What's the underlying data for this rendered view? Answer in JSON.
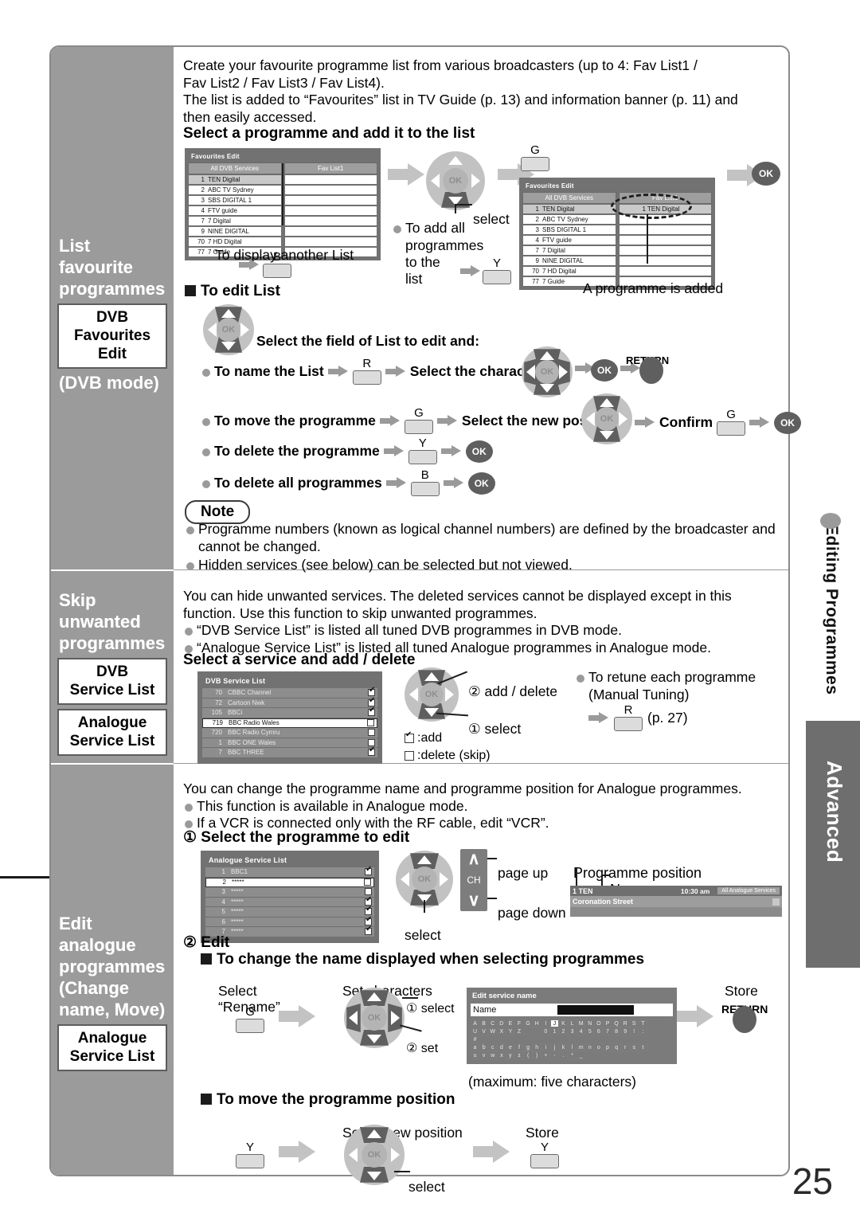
{
  "page": {
    "number": "25"
  },
  "side_tabs": {
    "editing": "Editing Programmes",
    "advanced": "Advanced"
  },
  "sidebar": {
    "sections": [
      {
        "title": "List\nfavourite\nprogrammes",
        "boxes": [
          "DVB\nFavourites\nEdit"
        ],
        "mode": "(DVB mode)"
      },
      {
        "title": "Skip\nunwanted\nprogrammes",
        "boxes": [
          "DVB\nService List",
          "Analogue\nService List"
        ],
        "mode": ""
      },
      {
        "title": "Edit analogue\nprogrammes\n(Change\nname, Move)",
        "boxes": [
          "Analogue\nService List"
        ],
        "mode": ""
      }
    ]
  },
  "section1": {
    "intro_l1": "Create your favourite programme list from various broadcasters (up to 4: Fav List1 /",
    "intro_l2": "Fav List2 / Fav List3 / Fav List4).",
    "intro_l3": "The list is added to “Favourites” list in TV Guide (p. 13) and information banner (p. 11) and",
    "intro_l4": "then easily accessed.",
    "heading": "Select a programme and add it to the list",
    "tv1": {
      "title": "Favourites Edit",
      "col_left": "All DVB Services",
      "col_right": "Fav List1",
      "rows": [
        {
          "num": "1",
          "name": "TEN Digital",
          "selected": true
        },
        {
          "num": "2",
          "name": "ABC TV Sydney",
          "selected": false
        },
        {
          "num": "3",
          "name": "SBS DIGITAL 1",
          "selected": false
        },
        {
          "num": "4",
          "name": "FTV guide",
          "selected": false
        },
        {
          "num": "7",
          "name": "7 Digital",
          "selected": false
        },
        {
          "num": "9",
          "name": "NINE DIGITAL",
          "selected": false
        },
        {
          "num": "70",
          "name": "7 HD Digital",
          "selected": false
        },
        {
          "num": "77",
          "name": "7 Guide",
          "selected": false
        }
      ]
    },
    "caption_another_list": "To display another List",
    "key_b": "B",
    "select_label": "select",
    "add_all_l1": "To add all",
    "add_all_l2": "programmes",
    "add_all_l3": "to the list",
    "key_y": "Y",
    "key_g": "G",
    "ok_label": "OK",
    "tv2": {
      "title": "Favourites Edit",
      "col_left": "All DVB Services",
      "col_right": "Fav List1",
      "added_value": "1 TEN Digital"
    },
    "caption_added": "A programme is added",
    "edit_list_heading": "To edit List",
    "select_field_text": "Select the field of List to edit and:",
    "steps": [
      {
        "label": "To name the List",
        "key": "R",
        "mid": "Select the character",
        "confirm": "",
        "confirm_key": "",
        "return_label": "RETURN"
      },
      {
        "label": "To move the programme",
        "key": "G",
        "mid": "Select the new position",
        "confirm": "Confirm",
        "confirm_key": "G",
        "return_label": ""
      },
      {
        "label": "To delete the programme",
        "key": "Y",
        "mid": "",
        "confirm": "",
        "confirm_key": "",
        "return_label": ""
      },
      {
        "label": "To delete all programmes",
        "key": "B",
        "mid": "",
        "confirm": "",
        "confirm_key": "",
        "return_label": ""
      }
    ],
    "note": {
      "title": "Note",
      "items": [
        "Programme numbers (known as logical channel numbers) are defined by the broadcaster and cannot be changed.",
        "Hidden services (see below) can be selected but not viewed."
      ]
    }
  },
  "section2": {
    "intro_l1": "You can hide unwanted services. The deleted services cannot be displayed except in this",
    "intro_l2": "function. Use this function to skip unwanted programmes.",
    "bullets": [
      "“DVB Service List” is listed all tuned DVB programmes in DVB mode.",
      "“Analogue Service List” is listed all tuned Analogue programmes in Analogue mode."
    ],
    "heading": "Select a service and add / delete",
    "tv": {
      "title": "DVB Service List",
      "rows": [
        {
          "num": "70",
          "name": "CBBC Channel",
          "checked": true,
          "highlight": false
        },
        {
          "num": "72",
          "name": "Cartoon Nwk",
          "checked": true,
          "highlight": false
        },
        {
          "num": "105",
          "name": "BBCi",
          "checked": true,
          "highlight": false
        },
        {
          "num": "719",
          "name": "BBC Radio Wales",
          "checked": false,
          "highlight": true
        },
        {
          "num": "720",
          "name": "BBC Radio Cymru",
          "checked": false,
          "highlight": false
        },
        {
          "num": "1",
          "name": "BBC ONE Wales",
          "checked": false,
          "highlight": false
        },
        {
          "num": "7",
          "name": "BBC THREE",
          "checked": true,
          "highlight": false
        }
      ]
    },
    "callout_add_delete": "② add / delete",
    "callout_select": "① select",
    "legend_add": ":add",
    "legend_delete": ":delete (skip)",
    "retune_l1": "To retune each programme",
    "retune_l2": "(Manual Tuning)",
    "retune_key": "R",
    "retune_page": "(p. 27)"
  },
  "section3": {
    "intro": "You can change the programme name and programme position for Analogue programmes.",
    "bullets": [
      "This function is available in Analogue mode.",
      "If a VCR is connected only with the RF cable, edit “VCR”."
    ],
    "step1_heading": "① Select the programme to edit",
    "tv": {
      "title": "Analogue Service List",
      "rows": [
        {
          "num": "1",
          "name": "BBC1",
          "checked": true,
          "highlight": false
        },
        {
          "num": "2",
          "name": "*****",
          "checked": false,
          "highlight": true
        },
        {
          "num": "3",
          "name": "*****",
          "checked": false,
          "highlight": false
        },
        {
          "num": "4",
          "name": "*****",
          "checked": true,
          "highlight": false
        },
        {
          "num": "5",
          "name": "*****",
          "checked": true,
          "highlight": false
        },
        {
          "num": "6",
          "name": "*****",
          "checked": true,
          "highlight": false
        },
        {
          "num": "7",
          "name": "*****",
          "checked": true,
          "highlight": false
        }
      ]
    },
    "select_label": "select",
    "ch_label": "CH",
    "page_up": "page up",
    "page_down": "page down",
    "label_position": "Programme position",
    "label_name": "Name",
    "banner": {
      "position": "1 TEN",
      "time": "10:30 am",
      "source": "All Analogue Services",
      "programme": "Coronation Street"
    },
    "step2_heading": "② Edit",
    "change_name_heading": "To change the name displayed when selecting programmes",
    "select_l1": "Select",
    "select_l2": "“Rename”",
    "key_g": "G",
    "set_characters": "Set characters",
    "cb_select": "① select",
    "cb_set": "② set",
    "store": "Store",
    "return_label": "RETURN",
    "dialog": {
      "title": "Edit service name",
      "field_label": "Name"
    },
    "keyboard": [
      [
        "A",
        "B",
        "C",
        "D",
        "E",
        "F",
        "G",
        "H",
        "I",
        "J",
        "K",
        "L",
        "M",
        "N",
        "O",
        "P",
        "Q",
        "R",
        "S",
        "T"
      ],
      [
        "U",
        "V",
        "W",
        "X",
        "Y",
        "Z",
        "",
        "",
        "0",
        "1",
        "2",
        "3",
        "4",
        "5",
        "6",
        "7",
        "8",
        "9",
        "!",
        ":",
        "#"
      ],
      [
        "a",
        "b",
        "c",
        "d",
        "e",
        "f",
        "g",
        "h",
        "i",
        "j",
        "k",
        "l",
        "m",
        "n",
        "o",
        "p",
        "q",
        "r",
        "s",
        "t"
      ],
      [
        "u",
        "v",
        "w",
        "x",
        "y",
        "z",
        "(",
        ")",
        "+",
        "-",
        ".",
        "*",
        "_"
      ]
    ],
    "keyboard_highlight": "J",
    "max_chars": "(maximum: five characters)",
    "move_heading": "To move the programme position",
    "move_select_new": "Select new position",
    "move_store": "Store",
    "move_key": "Y",
    "move_select_label": "select"
  }
}
